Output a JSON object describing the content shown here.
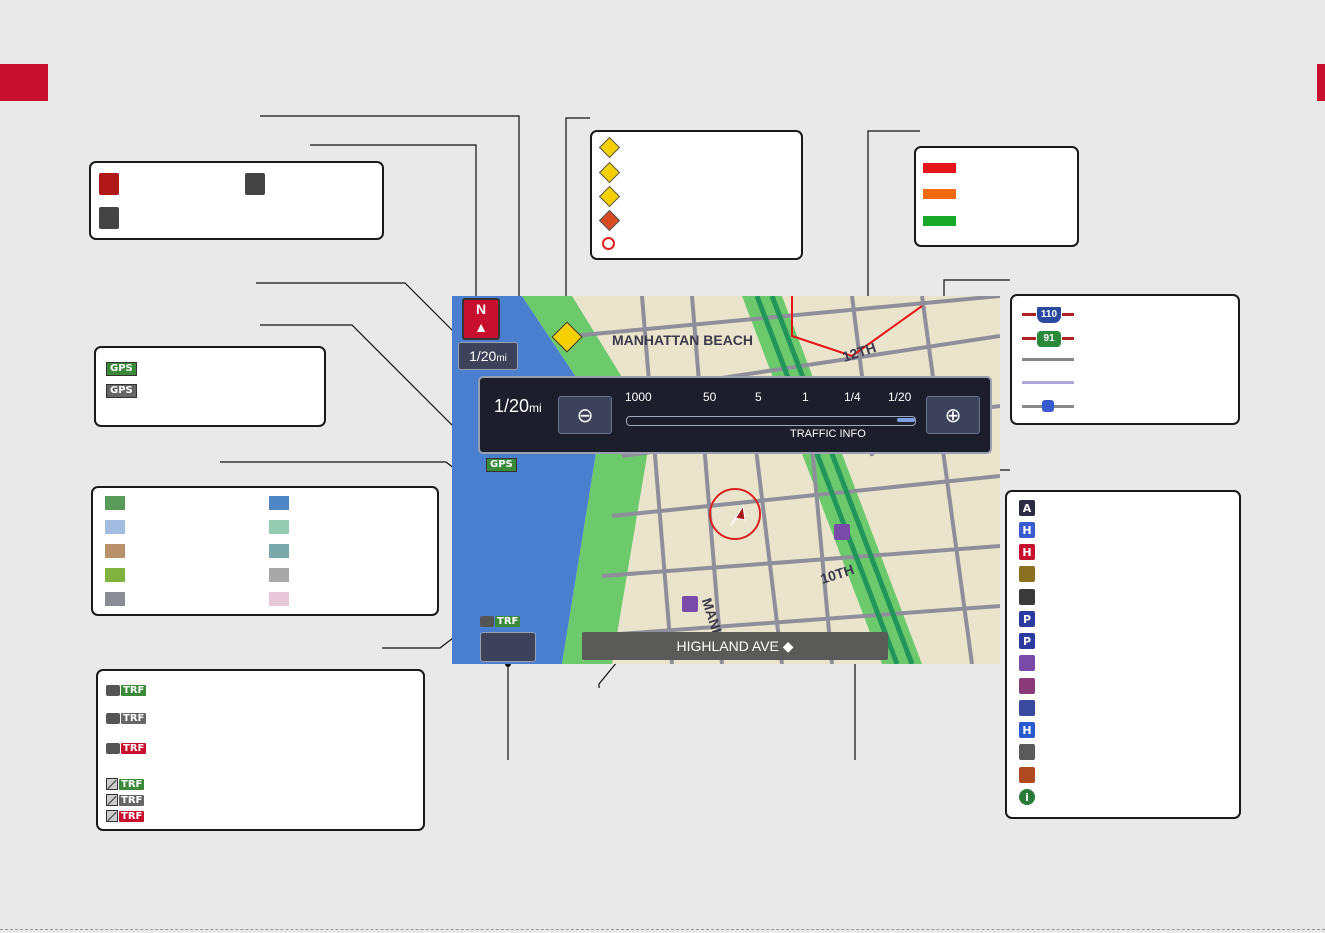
{
  "scale_values": [
    "1000",
    "50",
    "5",
    "1",
    "1/4",
    "1/20"
  ],
  "scale_current": "1/20",
  "scale_unit": "mi",
  "traffic_info_label": "TRAFFIC INFO",
  "gps_label": "GPS",
  "trf_label": "TRF",
  "street_name": "HIGHLAND AVE",
  "map_labels": {
    "city": "MANHATTAN BEACH",
    "street_12th": "12TH",
    "street_10th": "10TH",
    "street_manha": "MANHA"
  },
  "shields": {
    "interstate": "110",
    "state": "91"
  },
  "colors": {
    "traffic": [
      "#e8141c",
      "#f26a10",
      "#18a82a"
    ],
    "map_legend": [
      "#5a9b5a",
      "#4f86c6",
      "#a3bde0",
      "#95ccb0",
      "#b8916a",
      "#78a8aa",
      "#7fb23e",
      "#a8a8a8",
      "#8b8d94",
      "#e8c8d8"
    ],
    "accent_red": "#c8102e"
  },
  "icons": {
    "incident": [
      "construction-icon",
      "caution-icon",
      "accident-icon",
      "road-work-icon",
      "road-closed-icon"
    ],
    "poi": [
      "acura-dealer-icon",
      "honda-dealer-icon",
      "honda-dealer-red-icon",
      "atm-icon",
      "gas-station-icon",
      "parking-garage-icon",
      "parking-lot-icon",
      "shopping-icon",
      "hotel-icon",
      "fuel-icon",
      "hospital-icon",
      "auto-service-icon",
      "restaurant-icon",
      "info-icon"
    ]
  }
}
